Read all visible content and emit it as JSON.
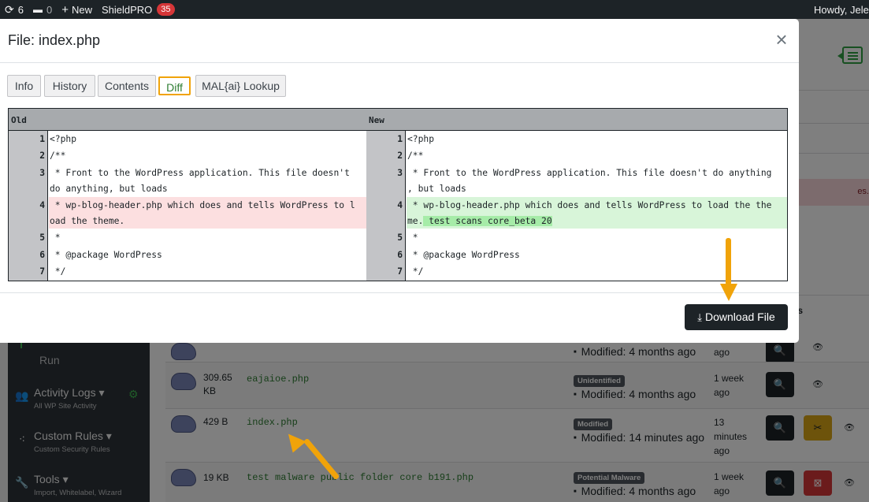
{
  "admin_bar": {
    "updates_count": "6",
    "comments_count": "0",
    "new_label": "New",
    "plugin_label": "ShieldPRO",
    "plugin_badge": "35",
    "howdy": "Howdy, Jele"
  },
  "sidebar": {
    "run_label": "Run",
    "items": [
      {
        "label": "Activity Logs",
        "sub": "All WP Site Activity",
        "icon": "users-icon"
      },
      {
        "label": "Custom Rules",
        "sub": "Custom Security Rules",
        "icon": "network-icon"
      },
      {
        "label": "Tools",
        "sub": "Import, Whitelabel, Wizard",
        "icon": "wrench-icon"
      }
    ]
  },
  "page": {
    "notice_fragment": "es.",
    "column_fragment": "s"
  },
  "files": [
    {
      "modified": "Modified: 4 months ago",
      "date": "ago"
    },
    {
      "size": "309.65 KB",
      "name": "eajaioe.php",
      "badge": "Unidentified",
      "modified": "Modified: 4 months ago",
      "date": "1 week ago"
    },
    {
      "size": "429 B",
      "name": "index.php",
      "badge": "Modified",
      "modified": "Modified: 14 minutes ago",
      "date": "13 minutes ago"
    },
    {
      "size": "19 KB",
      "name": "test malware public folder core b191.php",
      "badge": "Potential Malware",
      "modified": "Modified: 4 months ago",
      "date": "1 week ago"
    }
  ],
  "modal": {
    "title": "File: index.php",
    "close": "×",
    "tabs": [
      "Info",
      "History",
      "Contents",
      "Diff",
      "MAL{ai} Lookup"
    ],
    "active_tab": "Diff",
    "download_label": "Download File"
  },
  "diff": {
    "old_header": "Old",
    "new_header": "New",
    "old_lines": [
      {
        "num": "1",
        "text": "<?php"
      },
      {
        "num": "2",
        "text": "/**"
      },
      {
        "num": "3",
        "text": " * Front to the WordPress application. This file doesn't",
        "cont": "do anything, but loads"
      },
      {
        "num": "4",
        "text": " * wp-blog-header.php which does and tells WordPress to l",
        "cont": "oad the theme.",
        "type": "removed"
      },
      {
        "num": "5",
        "text": " *"
      },
      {
        "num": "6",
        "text": " * @package WordPress"
      },
      {
        "num": "7",
        "text": " */"
      }
    ],
    "new_lines": [
      {
        "num": "1",
        "text": "<?php"
      },
      {
        "num": "2",
        "text": "/**"
      },
      {
        "num": "3",
        "text": " * Front to the WordPress application. This file doesn't do anything",
        "cont": ", but loads"
      },
      {
        "num": "4",
        "text": " * wp-blog-header.php which does and tells WordPress to load the the",
        "cont": "me.",
        "added": " test scans core_beta 20",
        "type": "added"
      },
      {
        "num": "5",
        "text": " *"
      },
      {
        "num": "6",
        "text": " * @package WordPress"
      },
      {
        "num": "7",
        "text": " */"
      }
    ]
  },
  "colors": {
    "accent_orange": "#f0a30a",
    "diff_removed": "#fcdfe0",
    "diff_added": "#d8f5d9",
    "filename_green": "#2e7d32",
    "badge_red": "#d63638"
  }
}
